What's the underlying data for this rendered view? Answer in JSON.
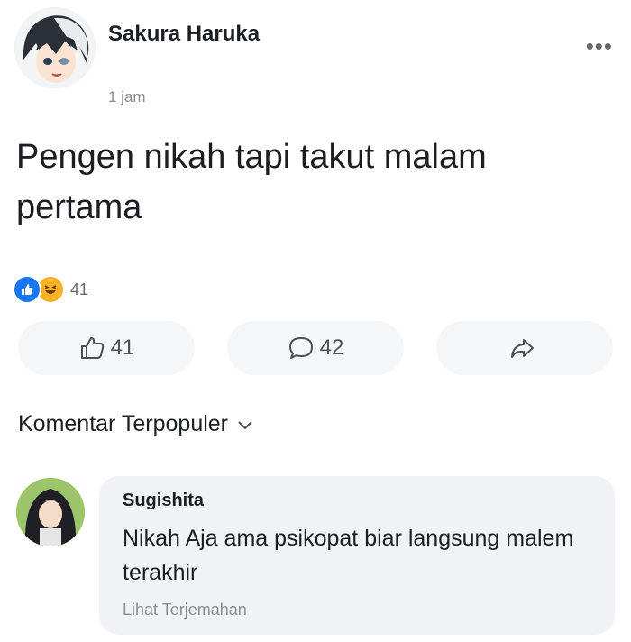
{
  "post": {
    "author": "Sakura Haruka",
    "timestamp": "1 jam",
    "text": "Pengen nikah tapi takut malam pertama",
    "more_icon": "more-dots-icon",
    "reactions": {
      "types": [
        "like",
        "haha"
      ],
      "count": "41"
    },
    "actions": {
      "like_count": "41",
      "comment_count": "42"
    }
  },
  "comments_section": {
    "filter_label": "Komentar Terpopuler"
  },
  "comment": {
    "author": "Sugishita",
    "text": "Nikah Aja ama psikopat biar langsung malem terakhir",
    "translate_label": "Lihat Terjemahan"
  },
  "colors": {
    "like_blue": "#1877f2",
    "haha_yellow": "#f7b125",
    "bubble_bg": "#f0f2f5",
    "muted_text": "#8a8d91"
  }
}
